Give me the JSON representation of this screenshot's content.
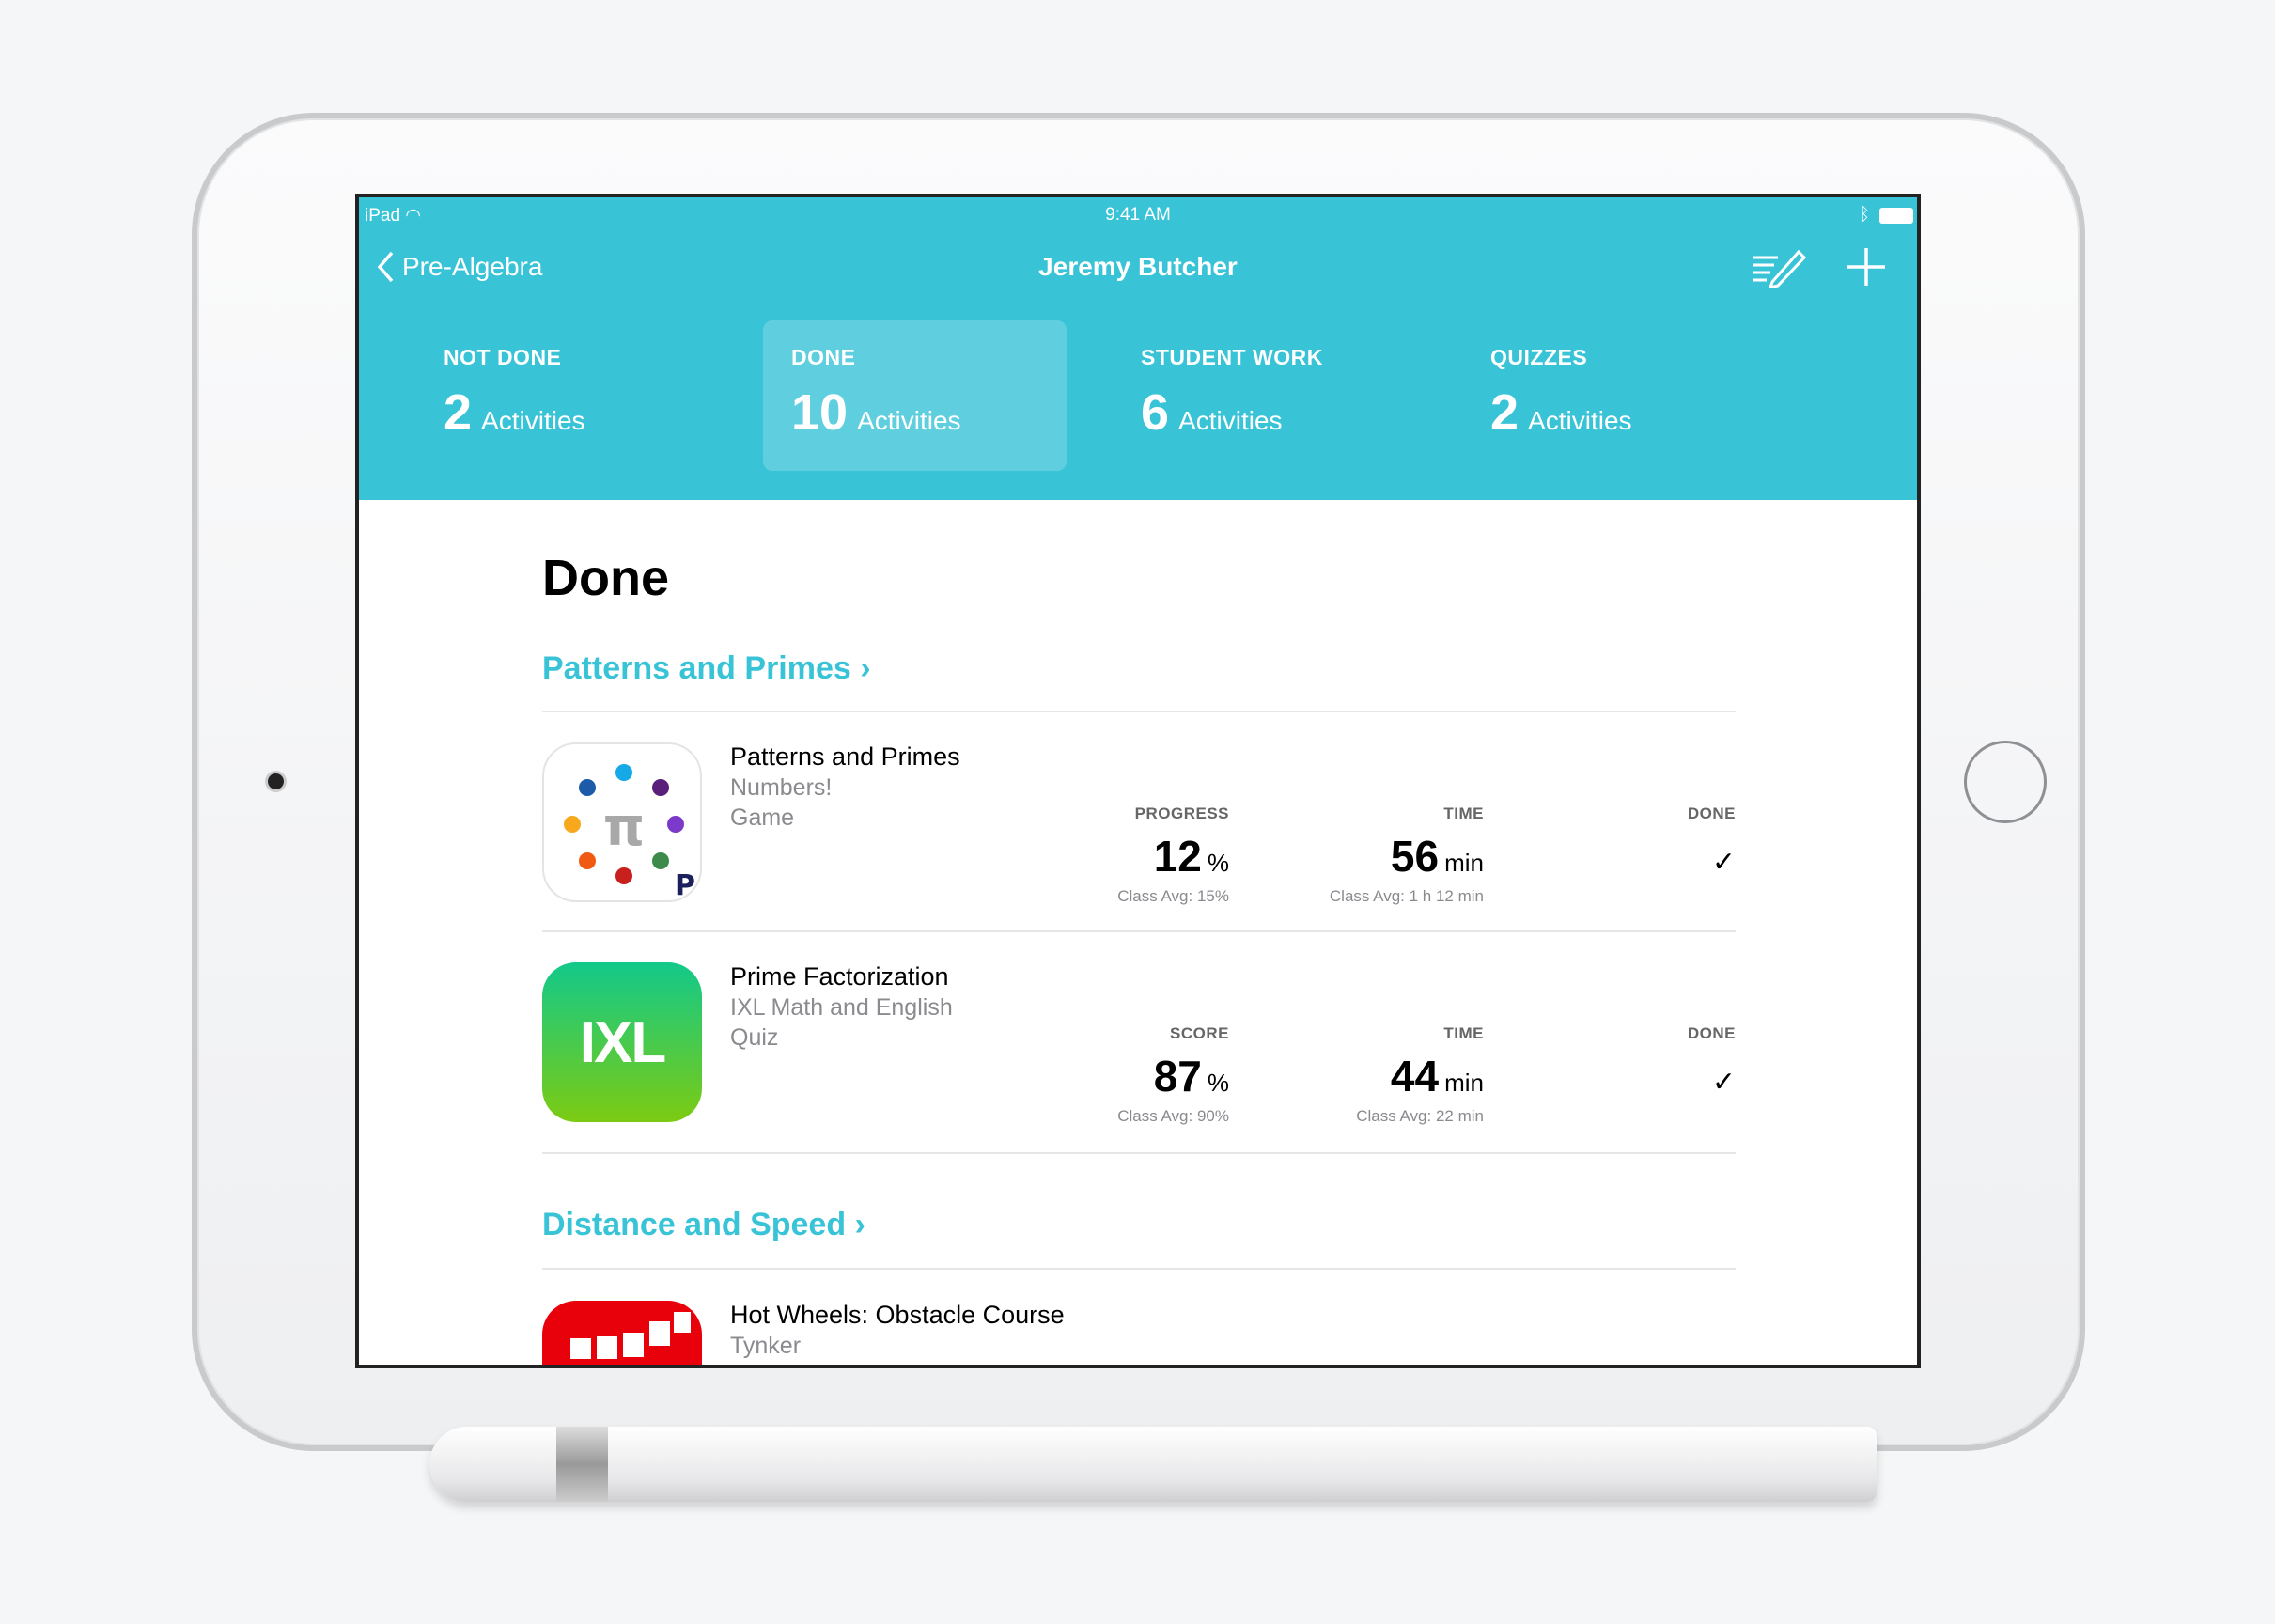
{
  "status_bar": {
    "device": "iPad",
    "time": "9:41 AM"
  },
  "nav": {
    "back_label": "Pre-Algebra",
    "title": "Jeremy Butcher"
  },
  "tabs": [
    {
      "label": "NOT DONE",
      "count": "2",
      "unit": "Activities",
      "active": false
    },
    {
      "label": "DONE",
      "count": "10",
      "unit": "Activities",
      "active": true
    },
    {
      "label": "STUDENT WORK",
      "count": "6",
      "unit": "Activities",
      "active": false
    },
    {
      "label": "QUIZZES",
      "count": "2",
      "unit": "Activities",
      "active": false
    }
  ],
  "main": {
    "title": "Done",
    "sections": [
      {
        "title": "Patterns and Primes",
        "chevron": "›"
      },
      {
        "title": "Distance and Speed",
        "chevron": "›"
      }
    ],
    "rows": [
      {
        "title": "Patterns and Primes",
        "app": "Numbers!",
        "type": "Game",
        "stat1_label": "PROGRESS",
        "stat1_value": "12",
        "stat1_unit": "%",
        "stat1_avg": "Class Avg: 15%",
        "stat2_label": "TIME",
        "stat2_value": "56",
        "stat2_unit": "min",
        "stat2_avg": "Class Avg: 1 h 12 min",
        "done_label": "DONE",
        "done_mark": "✓"
      },
      {
        "title": "Prime Factorization",
        "app": "IXL Math and English",
        "type": "Quiz",
        "icon_text": "IXL",
        "stat1_label": "SCORE",
        "stat1_value": "87",
        "stat1_unit": "%",
        "stat1_avg": "Class Avg: 90%",
        "stat2_label": "TIME",
        "stat2_value": "44",
        "stat2_unit": "min",
        "stat2_avg": "Class Avg: 22 min",
        "done_label": "DONE",
        "done_mark": "✓"
      },
      {
        "title": "Hot Wheels: Obstacle Course",
        "app": "Tynker"
      }
    ]
  },
  "colors": {
    "accent": "#38c3d7",
    "ixl_top": "#12c98a",
    "ixl_bottom": "#7ccb12",
    "tynker": "#e8000b"
  }
}
